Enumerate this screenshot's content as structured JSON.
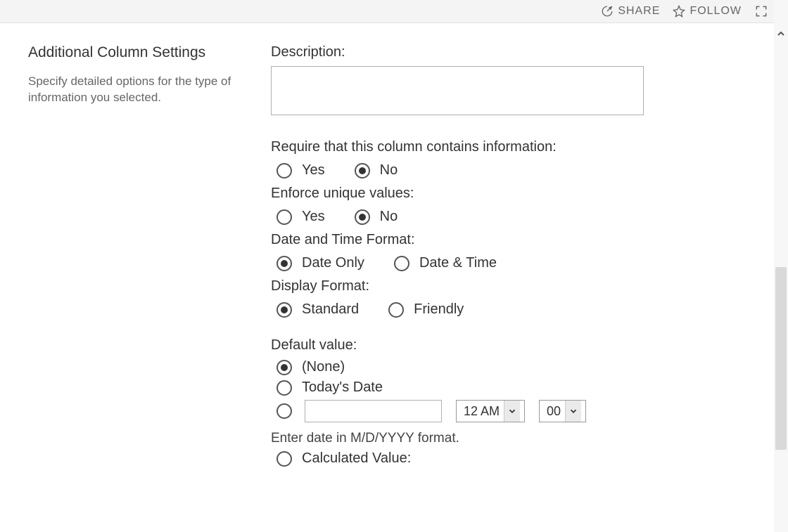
{
  "topbar": {
    "share": "SHARE",
    "follow": "FOLLOW"
  },
  "left": {
    "heading": "Additional Column Settings",
    "blurb": "Specify detailed options for the type of information you selected."
  },
  "fields": {
    "description_label": "Description:",
    "description_value": "",
    "require_label": "Require that this column contains information:",
    "require_yes": "Yes",
    "require_no": "No",
    "unique_label": "Enforce unique values:",
    "unique_yes": "Yes",
    "unique_no": "No",
    "datefmt_label": "Date and Time Format:",
    "datefmt_dateonly": "Date Only",
    "datefmt_datetime": "Date & Time",
    "display_label": "Display Format:",
    "display_standard": "Standard",
    "display_friendly": "Friendly",
    "default_label": "Default value:",
    "default_none": "(None)",
    "default_today": "Today's Date",
    "default_date_value": "",
    "default_hour": "12 AM",
    "default_minute": "00",
    "default_helper": "Enter date in M/D/YYYY format.",
    "default_calc": "Calculated Value:"
  }
}
